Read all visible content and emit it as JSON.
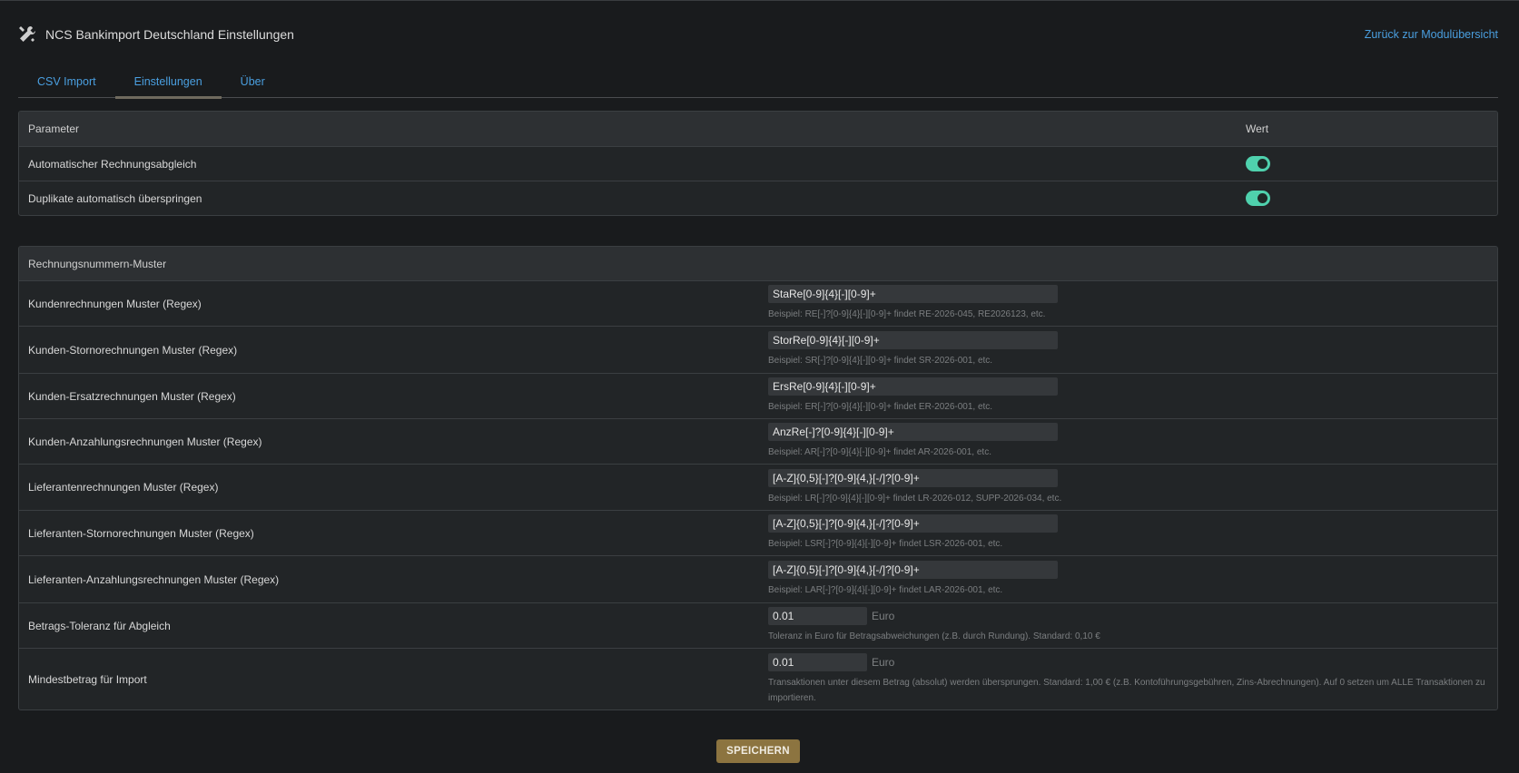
{
  "header": {
    "title": "NCS Bankimport Deutschland Einstellungen",
    "icon": "tools-icon",
    "back_link": "Zurück zur Modulübersicht"
  },
  "tabs": [
    {
      "label": "CSV Import"
    },
    {
      "label": "Einstellungen"
    },
    {
      "label": "Über"
    }
  ],
  "params_table": {
    "col_param": "Parameter",
    "col_value": "Wert",
    "rows": [
      {
        "label": "Automatischer Rechnungsabgleich",
        "enabled": true
      },
      {
        "label": "Duplikate automatisch überspringen",
        "enabled": true
      }
    ]
  },
  "patterns_table": {
    "title": "Rechnungsnummern-Muster",
    "rows": [
      {
        "label": "Kundenrechnungen Muster (Regex)",
        "value": "StaRe[0-9]{4}[-][0-9]+",
        "hint": "Beispiel: RE[-]?[0-9]{4}[-][0-9]+ findet RE-2026-045, RE2026123, etc."
      },
      {
        "label": "Kunden-Stornorechnungen Muster (Regex)",
        "value": "StorRe[0-9]{4}[-][0-9]+",
        "hint": "Beispiel: SR[-]?[0-9]{4}[-][0-9]+ findet SR-2026-001, etc."
      },
      {
        "label": "Kunden-Ersatzrechnungen Muster (Regex)",
        "value": "ErsRe[0-9]{4}[-][0-9]+",
        "hint": "Beispiel: ER[-]?[0-9]{4}[-][0-9]+ findet ER-2026-001, etc."
      },
      {
        "label": "Kunden-Anzahlungsrechnungen Muster (Regex)",
        "value": "AnzRe[-]?[0-9]{4}[-][0-9]+",
        "hint": "Beispiel: AR[-]?[0-9]{4}[-][0-9]+ findet AR-2026-001, etc."
      },
      {
        "label": "Lieferantenrechnungen Muster (Regex)",
        "value": "[A-Z]{0,5}[-]?[0-9]{4,}[-/]?[0-9]+",
        "hint": "Beispiel: LR[-]?[0-9]{4}[-][0-9]+ findet LR-2026-012, SUPP-2026-034, etc."
      },
      {
        "label": "Lieferanten-Stornorechnungen Muster (Regex)",
        "value": "[A-Z]{0,5}[-]?[0-9]{4,}[-/]?[0-9]+",
        "hint": "Beispiel: LSR[-]?[0-9]{4}[-][0-9]+ findet LSR-2026-001, etc."
      },
      {
        "label": "Lieferanten-Anzahlungsrechnungen Muster (Regex)",
        "value": "[A-Z]{0,5}[-]?[0-9]{4,}[-/]?[0-9]+",
        "hint": "Beispiel: LAR[-]?[0-9]{4}[-][0-9]+ findet LAR-2026-001, etc."
      },
      {
        "label": "Betrags-Toleranz für Abgleich",
        "value": "0.01",
        "unit": "Euro",
        "hint": "Toleranz in Euro für Betragsabweichungen (z.B. durch Rundung). Standard: 0,10 €"
      },
      {
        "label": "Mindestbetrag für Import",
        "value": "0.01",
        "unit": "Euro",
        "hint": "Transaktionen unter diesem Betrag (absolut) werden übersprungen. Standard: 1,00 € (z.B. Kontoführungsgebühren, Zins-Abrechnungen). Auf 0 setzen um ALLE Transaktionen zu importieren."
      }
    ]
  },
  "save_label": "SPEICHERN",
  "colors": {
    "accent": "#4a9fe0",
    "toggle": "#4fd1ad",
    "save": "#8c7440"
  }
}
